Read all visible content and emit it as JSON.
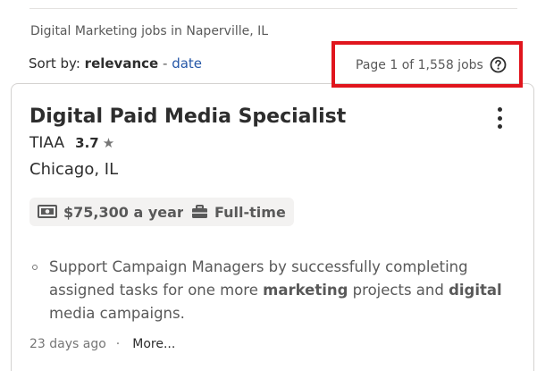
{
  "search": {
    "title": "Digital Marketing jobs in Naperville, IL",
    "sort_prefix": "Sort by:",
    "sort_active": "relevance",
    "sort_separator": "-",
    "sort_alternate": "date",
    "page_count": "Page 1 of 1,558 jobs"
  },
  "highlight": {
    "color": "#e0151d"
  },
  "job": {
    "title": "Digital Paid Media Specialist",
    "company": "TIAA",
    "rating": "3.7",
    "rating_icon": "star-icon",
    "location": "Chicago, IL",
    "salary": "$75,300 a year",
    "salary_icon": "money-icon",
    "job_type": "Full-time",
    "job_type_icon": "briefcase-icon",
    "snippet_parts": [
      "Support Campaign Managers by successfully completing assigned tasks for one more ",
      "marketing",
      " projects and ",
      "digital",
      " media campaigns."
    ],
    "posted": "23 days ago",
    "footer_separator": "·",
    "more_label": "More..."
  }
}
